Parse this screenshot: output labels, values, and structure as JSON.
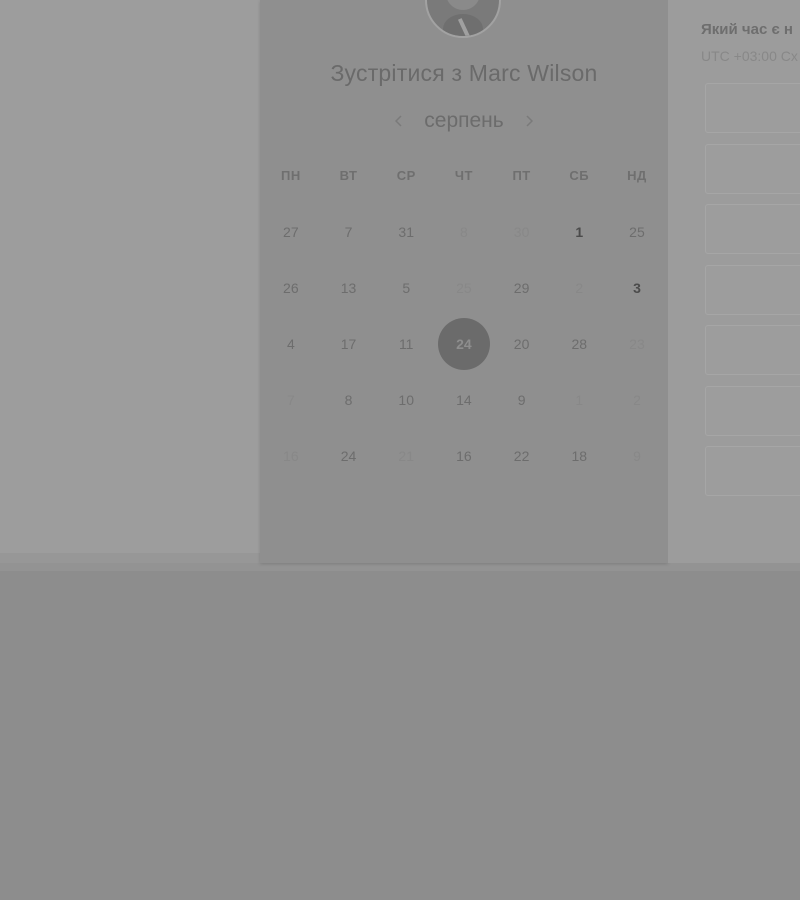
{
  "scheduler": {
    "title": "Зустрітися з Marc Wilson",
    "month": "серпень",
    "weekdays": [
      "ПН",
      "ВТ",
      "СР",
      "ЧТ",
      "ПТ",
      "СБ",
      "НД"
    ],
    "weeks": [
      [
        "27",
        "7",
        "31",
        "8",
        "30",
        "1",
        "25"
      ],
      [
        "26",
        "13",
        "5",
        "25",
        "29",
        "2",
        "3"
      ],
      [
        "4",
        "17",
        "11",
        "24",
        "20",
        "28",
        "23"
      ],
      [
        "7",
        "8",
        "10",
        "14",
        "9",
        "1",
        "2"
      ],
      [
        "16",
        "24",
        "21",
        "16",
        "22",
        "18",
        "9"
      ]
    ],
    "selected_day": "24"
  },
  "time_panel": {
    "question": "Який час є н",
    "timezone": "UTC +03:00 Сх",
    "slot_count_visible": 7
  },
  "colors": {
    "overlay_gray": "#8d8d8d",
    "selected_circle": "#6b6b6b"
  }
}
